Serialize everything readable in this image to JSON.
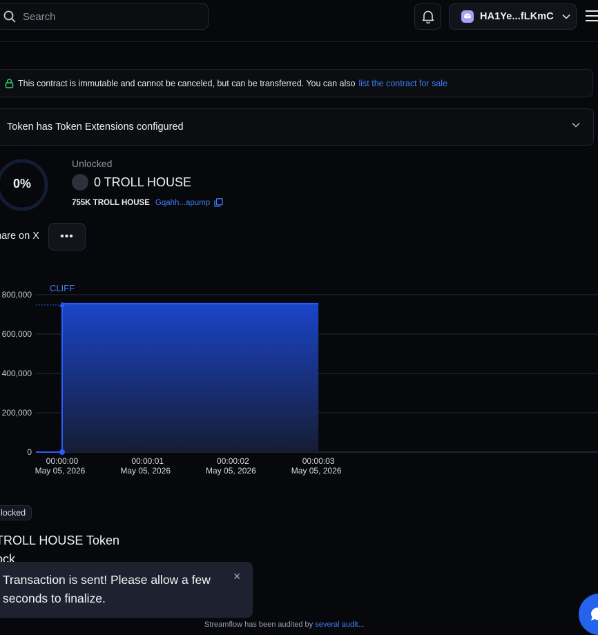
{
  "header": {
    "search_placeholder": "Search",
    "wallet_address": "HA1Ye...fLKmC",
    "icons": {
      "search": "search-icon",
      "bell": "bell-icon",
      "wallet": "phantom-ghost-icon",
      "menu": "menu-icon"
    }
  },
  "banner": {
    "text": "This contract is immutable and cannot be canceled, but can be transferred. You can also",
    "link": "list the contract for sale",
    "lock_color": "#2ecc71"
  },
  "extensions": {
    "label": "Token Extensions configured",
    "prefix": "Token has"
  },
  "progress": {
    "percent_label": "0%",
    "percent": 0,
    "status_label": "Unlocked",
    "amount": "0 TROLL HOUSE",
    "total": "755K TROLL HOUSE",
    "mint": "Gqahh...apump"
  },
  "actions": {
    "share": "hare on X",
    "more": "•••"
  },
  "chart_data": {
    "type": "area",
    "annotation": "CLIFF",
    "y_ticks": [
      "800,000",
      "600,000",
      "400,000",
      "200,000",
      "0"
    ],
    "ylim": [
      0,
      800000
    ],
    "x_ticks": [
      {
        "time": "00:00:00",
        "date": "May 05, 2026"
      },
      {
        "time": "00:00:01",
        "date": "May 05, 2026"
      },
      {
        "time": "00:00:02",
        "date": "May 05, 2026"
      },
      {
        "time": "00:00:03",
        "date": "May 05, 2026"
      }
    ],
    "series": [
      {
        "x": [
          0,
          0,
          3
        ],
        "y": [
          0,
          755000,
          755000
        ]
      }
    ],
    "fill_color": "#1a44c9",
    "line_color": "#2a5cff"
  },
  "status_badge": "locked",
  "contract_title": {
    "line1": "TROLL HOUSE Token",
    "line2": "ock"
  },
  "toast": {
    "message": "Transaction is sent! Please allow a few seconds to finalize.",
    "close": "×"
  },
  "footer": {
    "text": "Streamflow has been audited by",
    "link": "several audit..."
  }
}
